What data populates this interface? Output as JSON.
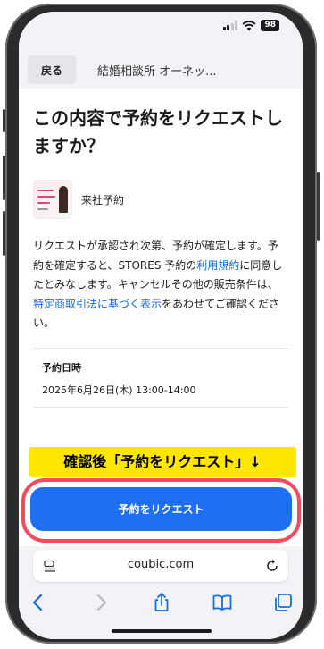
{
  "status_bar": {
    "battery": "98"
  },
  "nav": {
    "back_label": "戻る",
    "title": "結婚相談所 オーネッ..."
  },
  "main": {
    "headline": "この内容で予約をリクエストしますか？",
    "shop_name": "来社予約",
    "body_part1": "リクエストが承認され次第、予約が確定します。予約を確定すると、STORES 予約の",
    "link_terms": "利用規約",
    "body_part2": "に同意したとみなします。キャンセルその他の販売条件は、",
    "link_commerce": "特定商取引法に基づく表示",
    "body_part3": "をあわせてご確認ください。",
    "date_label": "予約日時",
    "date_value": "2025年6月26日(木) 13:00-14:00"
  },
  "annotation": "確認後「予約をリクエスト」↓",
  "cta": {
    "label": "予約をリクエスト"
  },
  "browser": {
    "url": "coubic.com"
  },
  "colors": {
    "accent": "#1f6ff2",
    "highlight_ring": "#ef4c5e",
    "annotation_bg": "#ffe600",
    "link": "#1a6ed8"
  }
}
